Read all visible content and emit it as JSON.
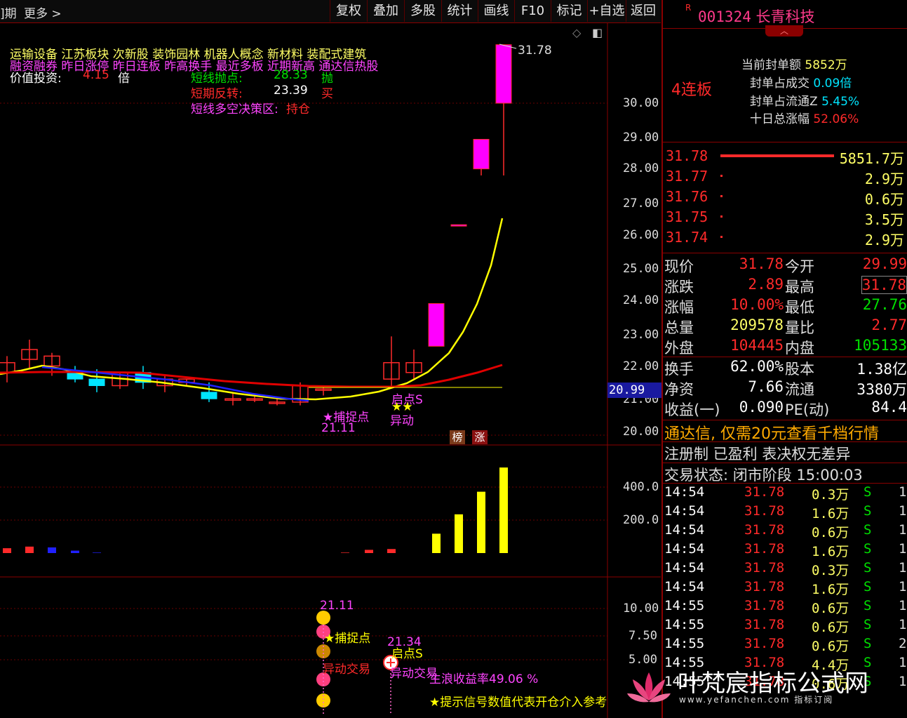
{
  "toolbar": {
    "left_fragment": "]期",
    "more": "更多",
    "buttons": [
      "复权",
      "叠加",
      "多股",
      "统计",
      "画线",
      "F10",
      "标记",
      "+自选",
      "返回"
    ]
  },
  "chart": {
    "concepts_line1": "运输设备   江苏板块   次新股  装饰园林  机器人概念  新材料  装配式建筑",
    "concepts_line2": "融资融券  昨日涨停  昨日连板  昨高换手  最近多板  近期新高  通达信热股",
    "value_label": "价值投资:",
    "value_num": "4.15",
    "value_unit": "倍",
    "sell_point_label": "短线抛点:",
    "sell_point_value": "28.33",
    "sell_point_tag": "抛",
    "reversal_label": "短期反转:",
    "reversal_value": "23.39",
    "reversal_tag": "买",
    "decision_label": "短线多空决策区:",
    "decision_value": "持仓",
    "high_label": "31.78",
    "price_ticks": [
      "30.00",
      "29.00",
      "28.00",
      "27.00",
      "26.00",
      "25.00",
      "24.00",
      "23.00",
      "22.00",
      "21.00",
      "20.00"
    ],
    "current_price_tag": "20.99",
    "catch_point": "★捕捉点",
    "catch_price": "21.11",
    "start_point": "启点S",
    "stars": "★★",
    "abnormal": "异动",
    "badge_bang": "榜",
    "badge_zhang": "涨",
    "vol_ticks": [
      "400.0",
      "200.0"
    ],
    "ind_ticks": [
      "10.00",
      "7.50",
      "5.00"
    ],
    "ind_price1": "21.11",
    "ind_catch": "★捕捉点",
    "ind_abnormal_trade": "异动交易",
    "ind_price2": "21.34",
    "ind_start": "启点S",
    "ind_abnormal_trade2": "异动交易",
    "ind_return": "主浪收益率49.06 %",
    "ind_tip": "★提示信号数值代表开仓介入参考"
  },
  "chart_data": [
    {
      "type": "candlestick",
      "title": "",
      "series": [
        {
          "name": "",
          "values": [
            {
              "o": 21.8,
              "h": 22.3,
              "l": 21.5,
              "c": 22.1
            },
            {
              "o": 22.2,
              "h": 22.8,
              "l": 21.9,
              "c": 22.5
            },
            {
              "o": 22.0,
              "h": 22.4,
              "l": 21.7,
              "c": 22.3
            },
            {
              "o": 21.8,
              "h": 22.0,
              "l": 21.5,
              "c": 21.6
            },
            {
              "o": 21.6,
              "h": 21.9,
              "l": 21.2,
              "c": 21.4
            },
            {
              "o": 21.4,
              "h": 21.8,
              "l": 21.3,
              "c": 21.8
            },
            {
              "o": 21.8,
              "h": 22.0,
              "l": 21.3,
              "c": 21.5
            },
            {
              "o": 21.4,
              "h": 21.7,
              "l": 21.2,
              "c": 21.6
            },
            {
              "o": 21.5,
              "h": 21.6,
              "l": 21.4,
              "c": 21.6
            },
            {
              "o": 21.2,
              "h": 21.5,
              "l": 20.9,
              "c": 21.0
            },
            {
              "o": 21.0,
              "h": 21.2,
              "l": 20.8,
              "c": 21.0
            },
            {
              "o": 21.0,
              "h": 21.1,
              "l": 20.9,
              "c": 21.0
            },
            {
              "o": 20.9,
              "h": 21.0,
              "l": 20.8,
              "c": 20.9
            },
            {
              "o": 20.9,
              "h": 21.5,
              "l": 20.8,
              "c": 21.4
            },
            {
              "o": 21.3,
              "h": 21.4,
              "l": 21.1,
              "c": 21.3
            },
            {
              "o": 21.6,
              "h": 22.9,
              "l": 21.4,
              "c": 22.1
            },
            {
              "o": 21.8,
              "h": 22.5,
              "l": 21.6,
              "c": 22.1
            },
            {
              "o": 22.6,
              "h": 23.9,
              "l": 22.6,
              "c": 23.9
            },
            {
              "o": 26.3,
              "h": 26.3,
              "l": 26.3,
              "c": 26.3
            },
            {
              "o": 28.0,
              "h": 28.9,
              "l": 27.8,
              "c": 28.9
            },
            {
              "o": 30.0,
              "h": 31.78,
              "l": 27.8,
              "c": 31.78
            }
          ]
        }
      ],
      "ylim": [
        20.0,
        31.78
      ]
    },
    {
      "type": "bar",
      "title": "",
      "values": [
        30,
        40,
        35,
        15,
        3,
        0,
        0,
        0,
        0,
        0,
        0,
        0,
        0,
        0,
        0,
        3,
        20,
        25,
        120,
        240,
        380,
        530
      ],
      "ylim": [
        0,
        550
      ]
    }
  ],
  "panel": {
    "code_prefix": "R",
    "code": "001324",
    "name": "长青科技",
    "limit_tag": "4连板",
    "seal_amount_label": "当前封单额",
    "seal_amount_value": "5852万",
    "seal_trade_label": "封单占成交",
    "seal_trade_value": "0.09倍",
    "seal_float_label": "封单占流通Z",
    "seal_float_value": "5.45%",
    "ten_day_label": "十日总涨幅",
    "ten_day_value": "52.06%",
    "bids": [
      {
        "price": "31.78",
        "vol": "5851.7万",
        "bar": 1.0
      },
      {
        "price": "31.77",
        "vol": "2.9万",
        "bar": 0.0
      },
      {
        "price": "31.76",
        "vol": "0.6万",
        "bar": 0.0
      },
      {
        "price": "31.75",
        "vol": "3.5万",
        "bar": 0.0
      },
      {
        "price": "31.74",
        "vol": "2.9万",
        "bar": 0.0
      }
    ],
    "quote": [
      {
        "l1": "现价",
        "v1": "31.78",
        "l2": "今开",
        "v2": "29.99"
      },
      {
        "l1": "涨跌",
        "v1": "2.89",
        "l2": "最高",
        "v2": "31.78"
      },
      {
        "l1": "涨幅",
        "v1": "10.00%",
        "l2": "最低",
        "v2": "27.76"
      },
      {
        "l1": "总量",
        "v1": "209578",
        "l2": "量比",
        "v2": "2.77"
      },
      {
        "l1": "外盘",
        "v1": "104445",
        "l2": "内盘",
        "v2": "105133"
      }
    ],
    "fund": [
      {
        "l1": "换手",
        "v1": "62.00%",
        "l2": "股本",
        "v2": "1.38亿"
      },
      {
        "l1": "净资",
        "v1": "7.66",
        "l2": "流通",
        "v2": "3380万"
      },
      {
        "l1": "收益(一)",
        "v1": "0.090",
        "l2": "PE(动)",
        "v2": "84.4"
      }
    ],
    "ad": "通达信, 仅需20元查看千档行情",
    "reg": "注册制 已盈利 表决权无差异",
    "status": "交易状态: 闭市阶段 15:00:03",
    "ticks": [
      {
        "t": "14:54",
        "p": "31.78",
        "v": "0.3万",
        "s": "S",
        "n": "1"
      },
      {
        "t": "14:54",
        "p": "31.78",
        "v": "1.6万",
        "s": "S",
        "n": "1"
      },
      {
        "t": "14:54",
        "p": "31.78",
        "v": "0.6万",
        "s": "S",
        "n": "1"
      },
      {
        "t": "14:54",
        "p": "31.78",
        "v": "1.6万",
        "s": "S",
        "n": "1"
      },
      {
        "t": "14:54",
        "p": "31.78",
        "v": "0.3万",
        "s": "S",
        "n": "1"
      },
      {
        "t": "14:54",
        "p": "31.78",
        "v": "1.6万",
        "s": "S",
        "n": "1"
      },
      {
        "t": "14:55",
        "p": "31.78",
        "v": "0.6万",
        "s": "S",
        "n": "1"
      },
      {
        "t": "14:55",
        "p": "31.78",
        "v": "0.6万",
        "s": "S",
        "n": "1"
      },
      {
        "t": "14:55",
        "p": "31.78",
        "v": "0.6万",
        "s": "S",
        "n": "2"
      },
      {
        "t": "14:55",
        "p": "31.78",
        "v": "4.4万",
        "s": "S",
        "n": "1"
      },
      {
        "t": "14:55",
        "p": "31.78",
        "v": "0.6万",
        "s": "S",
        "n": "1"
      }
    ]
  },
  "watermark": {
    "title": "叶梵宸指标公式网",
    "sub": "www.yefanchen.com 指标订阅"
  },
  "colors": {
    "up": "#ff2a2a",
    "down": "#00e5ff",
    "ma_yellow": "#ffff00",
    "ma_red": "#e00000",
    "ma_blue": "#2020ff",
    "magenta": "#ff00ff",
    "green": "#00e000",
    "grid": "#8a0000"
  }
}
